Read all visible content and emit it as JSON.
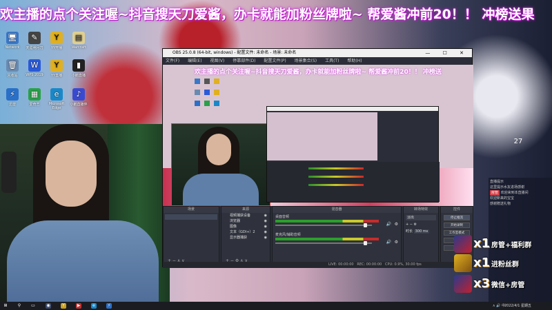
{
  "banner": {
    "text": "欢主播的点个关注喔~抖音搜天刀爱酱，办卡就能加粉丝牌啦~  帮爱酱冲前20！！ 冲榜送果"
  },
  "desktop": {
    "icons": [
      {
        "label": "Network",
        "glyph": "🖥"
      },
      {
        "label": "天涯明月刀",
        "glyph": "✎"
      },
      {
        "label": "YY开播",
        "glyph": "Y"
      },
      {
        "label": "Warcraft",
        "glyph": "▤"
      },
      {
        "label": "回收站",
        "glyph": "🗑"
      },
      {
        "label": "WPS 2019",
        "glyph": "W"
      },
      {
        "label": "YY直播",
        "glyph": "Y"
      },
      {
        "label": "小鹅直播",
        "glyph": "▮"
      },
      {
        "label": "迅雷",
        "glyph": "⚡"
      },
      {
        "label": "爱奇艺",
        "glyph": "▦"
      },
      {
        "label": "Microsoft Edge",
        "glyph": "e"
      },
      {
        "label": "小鹅直播伴",
        "glyph": "♪"
      }
    ]
  },
  "obs": {
    "title": "OBS 25.0.8 (64-bit, windows) - 配置文件: 未命名 - 场景: 未命名",
    "menu": [
      "文件(F)",
      "编辑(E)",
      "视图(V)",
      "停靠部件(D)",
      "配置文件(P)",
      "场景集合(S)",
      "工具(T)",
      "帮助(H)"
    ],
    "preview_banner": "欢主播的点个关注喔~抖音搜天刀爱酱，办卡就能加粉丝牌啦~  帮爱酱冲前20！！ 冲榜送",
    "docks": {
      "scenes_title": "场景",
      "sources_title": "来源",
      "mixer_title": "混音器",
      "transitions_title": "转场特效",
      "controls_title": "控件"
    },
    "sources": [
      {
        "name": "视频捕获设备"
      },
      {
        "name": "浏览器"
      },
      {
        "name": "图像"
      },
      {
        "name": "文本（GDI+）2"
      },
      {
        "name": "显示器捕获"
      }
    ],
    "mixer": [
      {
        "name": "桌面音频"
      },
      {
        "name": "麦克风/辅助音频"
      }
    ],
    "transition": {
      "label": "淡出",
      "duration_label": "时长",
      "duration_value": "300 ms"
    },
    "controls": [
      "停止推流",
      "开始录制",
      "工作室模式",
      "设置",
      "退出"
    ],
    "status": {
      "live": "LIVE: 00:00:00",
      "rec": "REC: 00:00:00",
      "cpu": "CPU: 0.9%, 30.00 fps"
    },
    "window_buttons": "— ☐ ✕"
  },
  "overlay": {
    "gifts": [
      {
        "count": "x1",
        "text": "房管+福利群"
      },
      {
        "count": "x1",
        "text": "进粉丝群"
      },
      {
        "count": "x3",
        "text": "微信+房管"
      }
    ],
    "clock": "27",
    "chat": [
      {
        "badge": "",
        "text": "直播提示"
      },
      {
        "badge": "",
        "text": "这里提示水友进场感谢"
      },
      {
        "badge": "房管",
        "text": "欢迎来到本直播间"
      },
      {
        "badge": "",
        "text": "欢迎新来的宝宝"
      },
      {
        "badge": "",
        "text": "感谢赠送礼物"
      }
    ]
  },
  "taskbar": {
    "time": "2022/4/1 星期五",
    "tray": "∧ 🔊 中"
  }
}
